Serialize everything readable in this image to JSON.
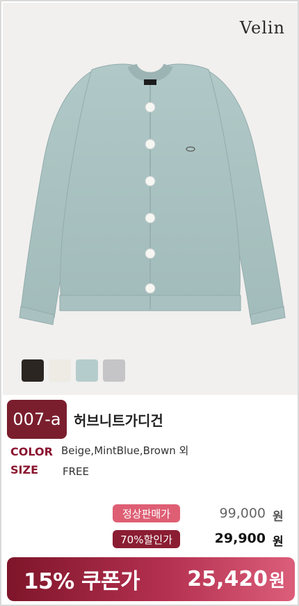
{
  "brand": "Velin",
  "swatches": [
    {
      "name": "black",
      "color": "#2b2622"
    },
    {
      "name": "beige",
      "color": "#eeebe4"
    },
    {
      "name": "mint-blue",
      "color": "#b5cccd"
    },
    {
      "name": "gray",
      "color": "#c5c4c7"
    }
  ],
  "product": {
    "code": "007-a",
    "name": "허브니트가디건",
    "color_label": "COLOR",
    "color_value": "Beige,MintBlue,Brown 외",
    "size_label": "SIZE",
    "size_value": "FREE"
  },
  "pricing": {
    "regular_tag": "정상판매가",
    "regular_price": "99,000",
    "sale_tag": "70%할인가",
    "sale_price": "29,900",
    "currency": "원",
    "coupon_label": "15% 쿠폰가",
    "coupon_price": "25,420"
  },
  "colors": {
    "accent_dark": "#7a1e2d",
    "accent_pink": "#de5f74",
    "cardigan": "#a9c2c1"
  }
}
